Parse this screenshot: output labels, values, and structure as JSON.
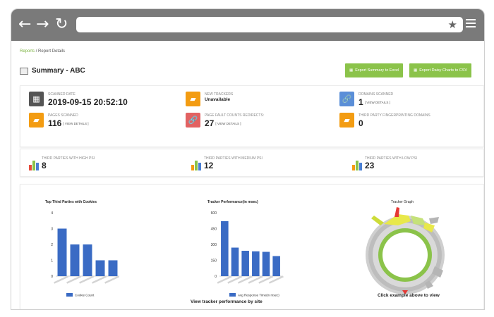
{
  "browser": {
    "back_icon": "arrow-left-icon",
    "forward_icon": "arrow-right-icon",
    "reload_icon": "reload-icon",
    "bookmark_icon": "star-icon",
    "menu_icon": "hamburger-icon"
  },
  "breadcrumb": {
    "root": "Reports",
    "separator": "/",
    "current": "Report Details"
  },
  "page": {
    "title": "Summary - ABC"
  },
  "actions": {
    "export_summary": "Export Summary to Excel",
    "export_daisy": "Export Daisy Charts to CSV",
    "accent": "#8bc34a"
  },
  "stats": {
    "scanned_date": {
      "label": "SCANNED DATE",
      "value": "2019-09-15 20:52:10"
    },
    "new_trackers": {
      "label": "NEW TRACKERS",
      "value": "Unavailable"
    },
    "domains_scanned": {
      "label": "DOMAINS SCANNED",
      "value": "1",
      "link": "[ VIEW DETAILS ]"
    },
    "pages_scanned": {
      "label": "PAGES SCANNED",
      "value": "116",
      "link": "[ VIEW DETAILS ]"
    },
    "page_fault": {
      "label": "PAGE FAULT COUNTS REDIRECTS:",
      "value": "27",
      "link": "[ VIEW DETAILS ]"
    },
    "third_party_fp": {
      "label": "THIRD PARTY FINGERPRINTING DOMAINS",
      "value": "0"
    }
  },
  "psi": {
    "high": {
      "label": "THIRD PARTIES WITH HIGH PSI",
      "value": "8"
    },
    "medium": {
      "label": "THIRD PARTIES WITH MEDIUM PSI",
      "value": "12"
    },
    "low": {
      "label": "THIRD PARTIES WITH LOW PSI",
      "value": "23"
    }
  },
  "charts": {
    "cookies": {
      "title": "Top Third Parties with Cookies",
      "legend": "Cookie Count"
    },
    "tracker_perf": {
      "title": "Tracker Performance(in msec)",
      "legend": "Avg Response Time(in msec)",
      "caption": "View tracker performance by site"
    },
    "tracker_graph": {
      "title": "Tracker Graph",
      "caption": "Click example above to view"
    }
  },
  "chart_data": [
    {
      "type": "bar",
      "title": "Top Third Parties with Cookies",
      "categories": [
        "",
        "",
        "",
        "",
        ""
      ],
      "values": [
        3,
        2,
        2,
        1,
        1
      ],
      "ylim": [
        0,
        4
      ],
      "yticks": [
        0,
        1,
        2,
        3,
        4
      ],
      "series": [
        {
          "name": "Cookie Count",
          "values": [
            3,
            2,
            2,
            1,
            1
          ]
        }
      ],
      "color": "#3a6bc4"
    },
    {
      "type": "bar",
      "title": "Tracker Performance(in msec)",
      "categories": [
        "",
        "",
        "",
        "",
        "",
        ""
      ],
      "values": [
        520,
        270,
        240,
        235,
        230,
        190
      ],
      "ylim": [
        0,
        600
      ],
      "yticks": [
        0,
        150,
        300,
        450,
        600
      ],
      "series": [
        {
          "name": "Avg Response Time(in msec)",
          "values": [
            520,
            270,
            240,
            235,
            230,
            190
          ]
        }
      ],
      "color": "#3a6bc4"
    }
  ]
}
